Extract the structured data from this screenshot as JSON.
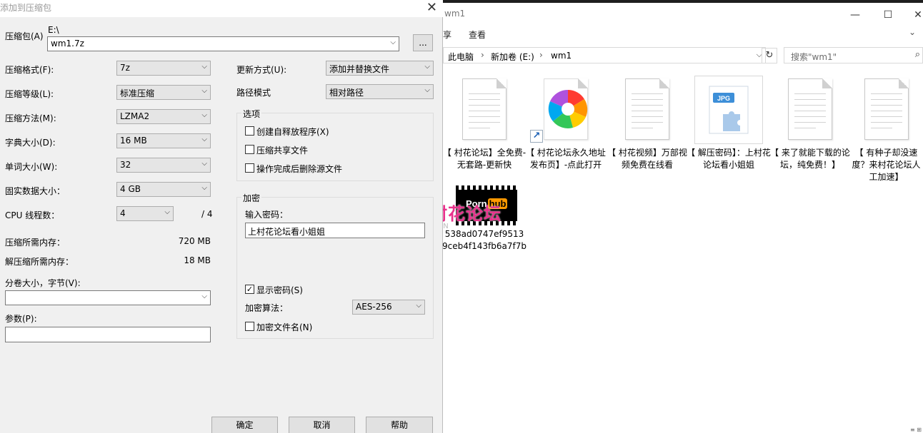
{
  "explorer": {
    "title": "wm1",
    "window_controls": {
      "minimize": "—",
      "maximize": "☐",
      "close": "✕"
    },
    "ribbon_tabs": [
      "享",
      "查看"
    ],
    "ribbon_expand": "⌄",
    "breadcrumb": [
      "此电脑",
      "新加卷 (E:)",
      "wm1"
    ],
    "breadcrumb_separator": "›",
    "addr_dropdown": "⌵",
    "refresh": "↻",
    "search_placeholder": "搜索\"wm1\"",
    "search_icon": "⌕",
    "jpg_badge": "JPG",
    "files": [
      {
        "name": "【 村花论坛】全免费-无套路-更新快",
        "icon": "document-icon"
      },
      {
        "name": "【 村花论坛永久地址发布页】-点此打开",
        "icon": "browser-shortcut-icon"
      },
      {
        "name": "【 村花视频】万部视频免费在线看",
        "icon": "document-icon"
      },
      {
        "name": "【 解压密码】：上村花论坛看小姐姐",
        "icon": "jpg-image-icon"
      },
      {
        "name": "【 来了就能下载的论坛，纯免费！】",
        "icon": "document-icon"
      },
      {
        "name": "【 有种子却没速度？来村花论坛人工加速】",
        "icon": "document-icon"
      },
      {
        "name": "538ad0747ef95139ceb4f143fb6a7f7b",
        "icon": "video-icon"
      }
    ],
    "video_logo": {
      "porn": "Porn",
      "hub": "hub"
    },
    "watermark": {
      "text": "村花论坛",
      "sub": "CUN"
    },
    "bottom_right": "≡ ⊞"
  },
  "dialog": {
    "title": "添加到压缩包",
    "close": "✕",
    "archive_label": "压缩包(A)",
    "archive_path": "E:\\",
    "archive_name": "wm1.7z",
    "browse_button": "...",
    "format_label": "压缩格式(F):",
    "format_value": "7z",
    "level_label": "压缩等级(L):",
    "level_value": "标准压缩",
    "method_label": "压缩方法(M):",
    "method_value": "LZMA2",
    "dict_label": "字典大小(D):",
    "dict_value": "16 MB",
    "word_label": "单词大小(W):",
    "word_value": "32",
    "solid_label": "固实数据大小：",
    "solid_value": "4 GB",
    "cpu_label": "CPU 线程数：",
    "cpu_value": "4",
    "cpu_total": "/ 4",
    "mem_comp_label": "压缩所需内存：",
    "mem_comp_value": "720 MB",
    "mem_decomp_label": "解压缩所需内存：",
    "mem_decomp_value": "18 MB",
    "volume_label": "分卷大小，字节(V):",
    "volume_value": "",
    "params_label": "参数(P):",
    "params_value": "",
    "update_label": "更新方式(U):",
    "update_value": "添加并替换文件",
    "path_label": "路径模式",
    "path_value": "相对路径",
    "options_group": "选项",
    "opt_sfx": "创建自释放程序(X)",
    "opt_shared": "压缩共享文件",
    "opt_delete": "操作完成后删除源文件",
    "encrypt_group": "加密",
    "password_label": "输入密码：",
    "password_value": "上村花论坛看小姐姐",
    "show_password": "显示密码(S)",
    "encrypt_method_label": "加密算法：",
    "encrypt_method_value": "AES-256",
    "encrypt_names": "加密文件名(N)",
    "ok_button": "确定",
    "cancel_button": "取消",
    "help_button": "帮助",
    "checked_mark": "✓",
    "dropdown_arrow": "⌵"
  }
}
